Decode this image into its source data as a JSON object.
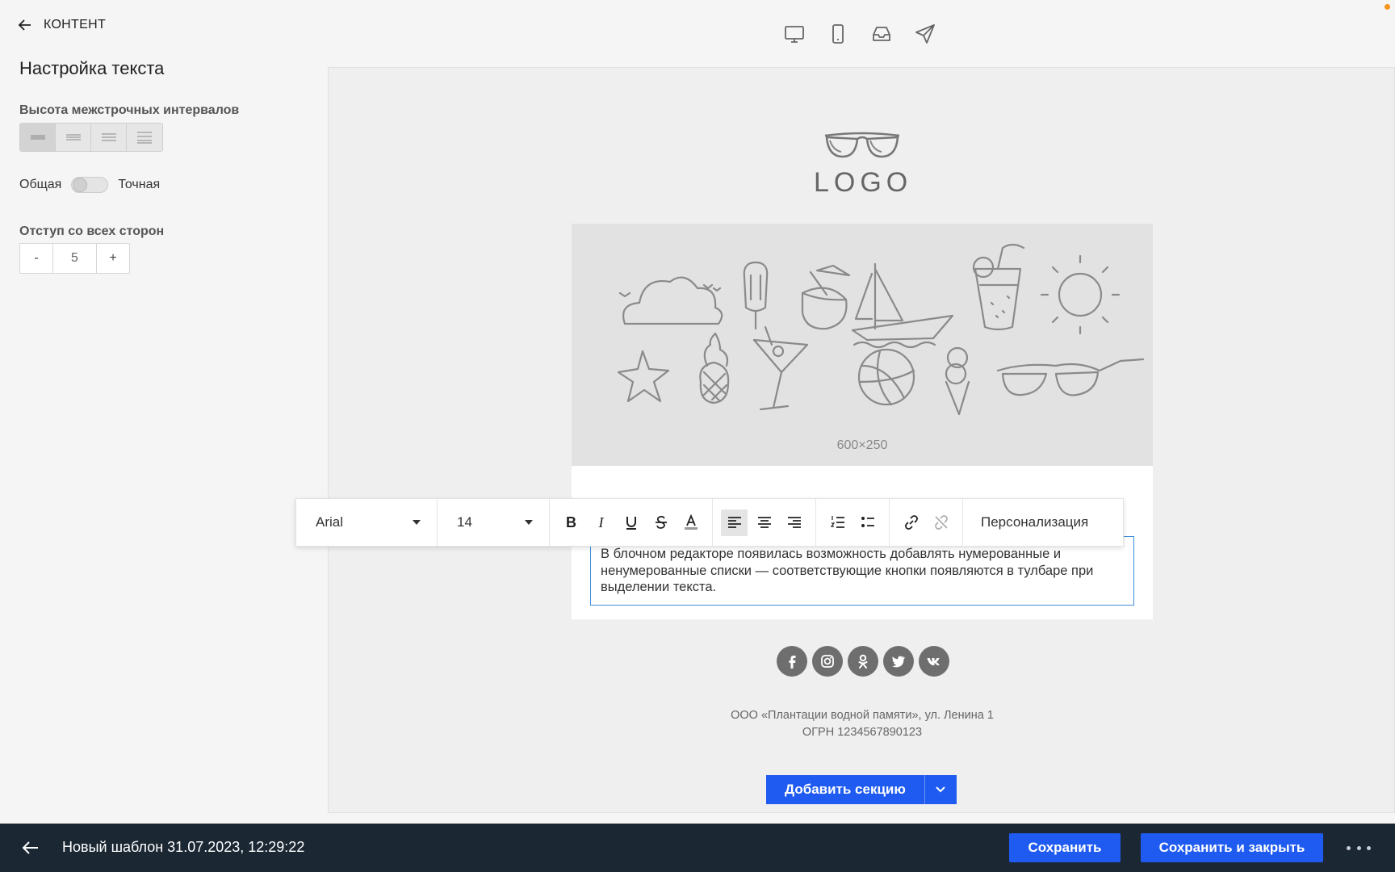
{
  "left_panel": {
    "back_label": "КОНТЕНТ",
    "title": "Настройка текста",
    "line_height_label": "Высота межстрочных интервалов",
    "toggle_left": "Общая",
    "toggle_right": "Точная",
    "padding_label": "Отступ со всех сторон",
    "padding_minus": "-",
    "padding_value": "5",
    "padding_plus": "+"
  },
  "device_bar": {
    "icons": [
      "desktop-icon",
      "mobile-icon",
      "inbox-icon",
      "send-icon"
    ]
  },
  "canvas": {
    "logo_text": "LOGO",
    "hero_size": "600×250",
    "body_text": "В блочном редакторе появилась возможность добавлять нумерованные и ненумерованные списки — соответствующие кнопки появляются в тулбаре при выделении текста.",
    "social_icons": [
      "facebook-icon",
      "instagram-icon",
      "odnoklassniki-icon",
      "twitter-icon",
      "vk-icon"
    ],
    "footer_line1": "ООО «Плантации водной памяти», ул. Ленина 1",
    "footer_line2": "ОГРН 1234567890123",
    "add_section": "Добавить секцию"
  },
  "toolbar": {
    "font": "Arial",
    "size": "14",
    "bold": "B",
    "italic": "I",
    "personalization": "Персонализация"
  },
  "bottom_bar": {
    "title": "Новый шаблон 31.07.2023, 12:29:22",
    "save": "Сохранить",
    "save_close": "Сохранить и закрыть"
  },
  "colors": {
    "accent": "#1f5bf0",
    "bottom_bar": "#1b2733",
    "selection_border": "#3c8bd9"
  }
}
